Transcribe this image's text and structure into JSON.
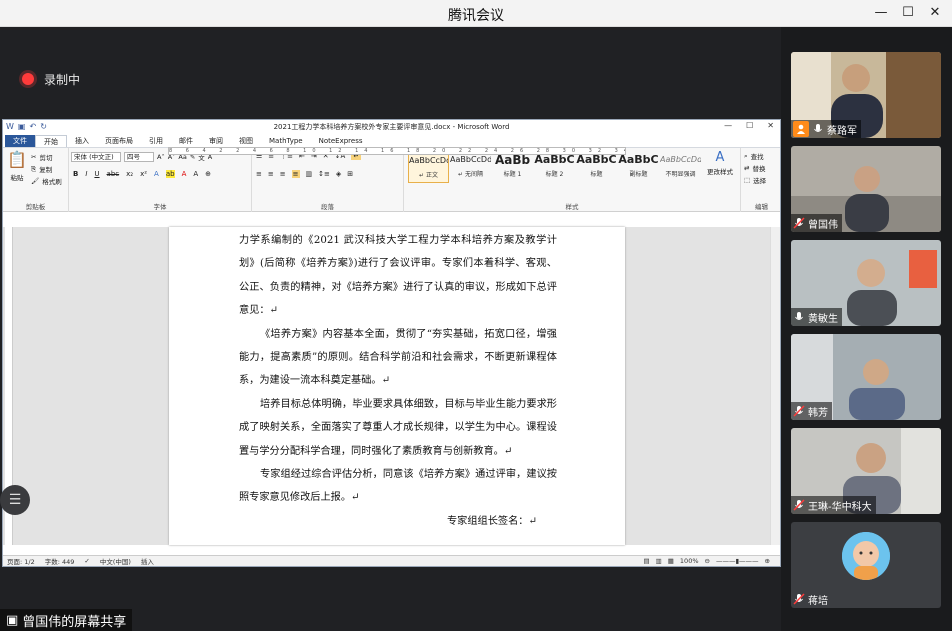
{
  "window": {
    "title": "腾讯会议",
    "min": "—",
    "max": "☐",
    "close": "✕"
  },
  "recording": {
    "label": "录制中"
  },
  "share": {
    "label": "曾国伟的屏幕共享"
  },
  "word": {
    "doc_title": "2021工程力学本科培养方案校外专家主要评审意见.docx - Microsoft Word",
    "tabs": [
      "文件",
      "开始",
      "插入",
      "页面布局",
      "引用",
      "邮件",
      "审阅",
      "视图",
      "MathType",
      "NoteExpress"
    ],
    "clipboard": {
      "paste": "粘贴",
      "cut": "剪切",
      "copy": "复制",
      "format_painter": "格式刷",
      "group": "剪贴板"
    },
    "font": {
      "name": "宋体 (中文正)",
      "size": "四号",
      "group": "字体"
    },
    "paragraph": {
      "group": "段落"
    },
    "styles": {
      "group": "样式",
      "items": [
        {
          "preview": "AaBbCcDd",
          "name": "↵ 正文"
        },
        {
          "preview": "AaBbCcDd",
          "name": "↵ 无间隔"
        },
        {
          "preview": "AaBb",
          "name": "标题 1"
        },
        {
          "preview": "AaBbC",
          "name": "标题 2"
        },
        {
          "preview": "AaBbC",
          "name": "标题"
        },
        {
          "preview": "AaBbC",
          "name": "副标题"
        },
        {
          "preview": "AaBbCcDd",
          "name": "不明显强调"
        }
      ],
      "change": "更改样式"
    },
    "editing": {
      "find": "查找",
      "replace": "替换",
      "select": "选择",
      "group": "编辑"
    },
    "ruler": "8 6 4 2 2 4 6 8 10 12 14 16 18 20 22 24 26 28 30 32 34 36 38 40 42 44 46 48",
    "body": [
      "力学系编制的《2021 武汉科技大学工程力学本科培养方案及教学计划》(后简称《培养方案》)进行了会议评审。专家们本着科学、客观、公正、负责的精神，对《培养方案》进行了认真的审议，形成如下总评意见：↵",
      "《培养方案》内容基本全面，贯彻了“夯实基础，拓宽口径，增强能力，提高素质”的原则。结合科学前沿和社会需求，不断更新课程体系，为建设一流本科奠定基础。↵",
      "培养目标总体明确，毕业要求具体细致，目标与毕业生能力要求形成了映射关系，全面落实了尊重人才成长规律，以学生为中心。课程设置与学分分配科学合理，同时强化了素质教育与创新教育。↵",
      "专家组经过综合评估分析，同意该《培养方案》通过评审，建议按照专家意见修改后上报。↵",
      "专家组组长签名：↵"
    ],
    "status": {
      "page": "页面: 1/2",
      "words": "字数: 449",
      "lang": "中文(中国)",
      "mode": "插入",
      "zoom": "100%"
    }
  },
  "participants": [
    {
      "name": "蔡路军",
      "role": "host",
      "bg": "#b79a74"
    },
    {
      "name": "曾国伟",
      "role": "muted",
      "bg": "#a9a59d"
    },
    {
      "name": "黄敏生",
      "role": "mic",
      "bg": "#b5b9b8"
    },
    {
      "name": "韩芳",
      "role": "muted",
      "bg": "#9aa3a9"
    },
    {
      "name": "王琳-华中科大",
      "role": "muted",
      "bg": "#b8b8b4"
    },
    {
      "name": "蒋培",
      "role": "muted",
      "bg": "#3c3e42"
    }
  ]
}
